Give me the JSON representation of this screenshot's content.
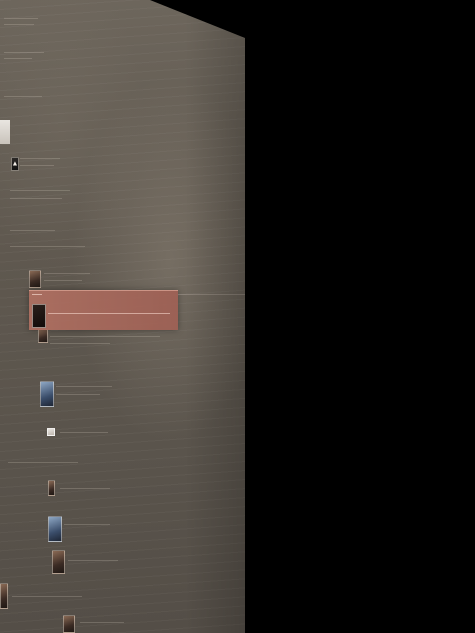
{
  "scene": {
    "background_color": "#000000",
    "panel_color": "#5f584f",
    "highlight_color": "#b07062"
  },
  "thumbnails": [
    {
      "name": "portrait-1",
      "style": "dark",
      "icon": "figure-icon"
    },
    {
      "name": "portrait-2",
      "style": "warm",
      "icon": ""
    },
    {
      "name": "portrait-3",
      "style": "warm",
      "icon": ""
    },
    {
      "name": "portrait-4",
      "style": "blue",
      "icon": ""
    },
    {
      "name": "portrait-5",
      "style": "light",
      "icon": ""
    },
    {
      "name": "portrait-6",
      "style": "warm",
      "icon": ""
    },
    {
      "name": "portrait-7",
      "style": "blue",
      "icon": ""
    },
    {
      "name": "portrait-8",
      "style": "warm",
      "icon": ""
    },
    {
      "name": "portrait-9",
      "style": "warm",
      "icon": ""
    },
    {
      "name": "portrait-10",
      "style": "warm",
      "icon": ""
    }
  ],
  "highlight_card": {
    "title": "",
    "icon": "portrait-icon"
  }
}
